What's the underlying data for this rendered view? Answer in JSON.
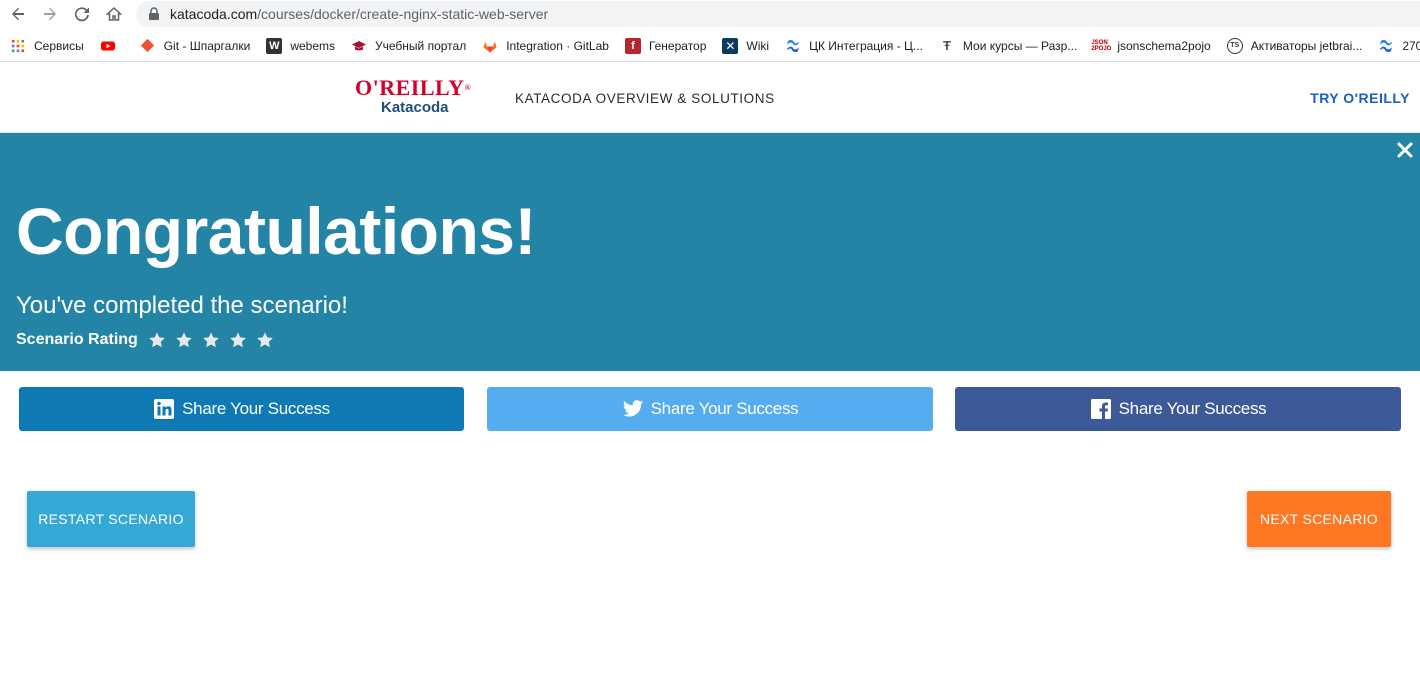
{
  "browser": {
    "url_host": "katacoda.com",
    "url_path": "/courses/docker/create-nginx-static-web-server",
    "bookmarks": [
      {
        "label": "Сервисы",
        "icon": "apps-grid-icon"
      },
      {
        "label": "",
        "icon": "youtube-icon"
      },
      {
        "label": "Git - Шпаргалки",
        "icon": "git-icon"
      },
      {
        "label": "webems",
        "icon": "w-icon"
      },
      {
        "label": "Учебный портал",
        "icon": "graduation-cap-icon"
      },
      {
        "label": "Integration · GitLab",
        "icon": "gitlab-icon"
      },
      {
        "label": "Генератор",
        "icon": "generator-icon"
      },
      {
        "label": "Wiki",
        "icon": "wiki-icon"
      },
      {
        "label": "ЦК Интеграция - Ц...",
        "icon": "confluence-icon"
      },
      {
        "label": "Мои курсы — Разр...",
        "icon": "courses-icon"
      },
      {
        "label": "jsonschema2pojo",
        "icon": "json-icon"
      },
      {
        "label": "Активаторы jetbrai...",
        "icon": "ts-icon"
      },
      {
        "label": "270",
        "icon": "confluence-icon"
      }
    ]
  },
  "header": {
    "logo_top": "O'REILLY",
    "logo_bottom": "Katacoda",
    "nav_overview": "KATACODA OVERVIEW & SOLUTIONS",
    "nav_try": "TRY O'REILLY"
  },
  "banner": {
    "title": "Congratulations!",
    "subtitle": "You've completed the scenario!",
    "rating_label": "Scenario Rating",
    "rating_stars": 5,
    "bg_color": "#2384a6"
  },
  "share": {
    "linkedin_label": "Share Your Success",
    "twitter_label": "Share Your Success",
    "facebook_label": "Share Your Success"
  },
  "actions": {
    "restart_label": "RESTART SCENARIO",
    "next_label": "NEXT SCENARIO"
  }
}
